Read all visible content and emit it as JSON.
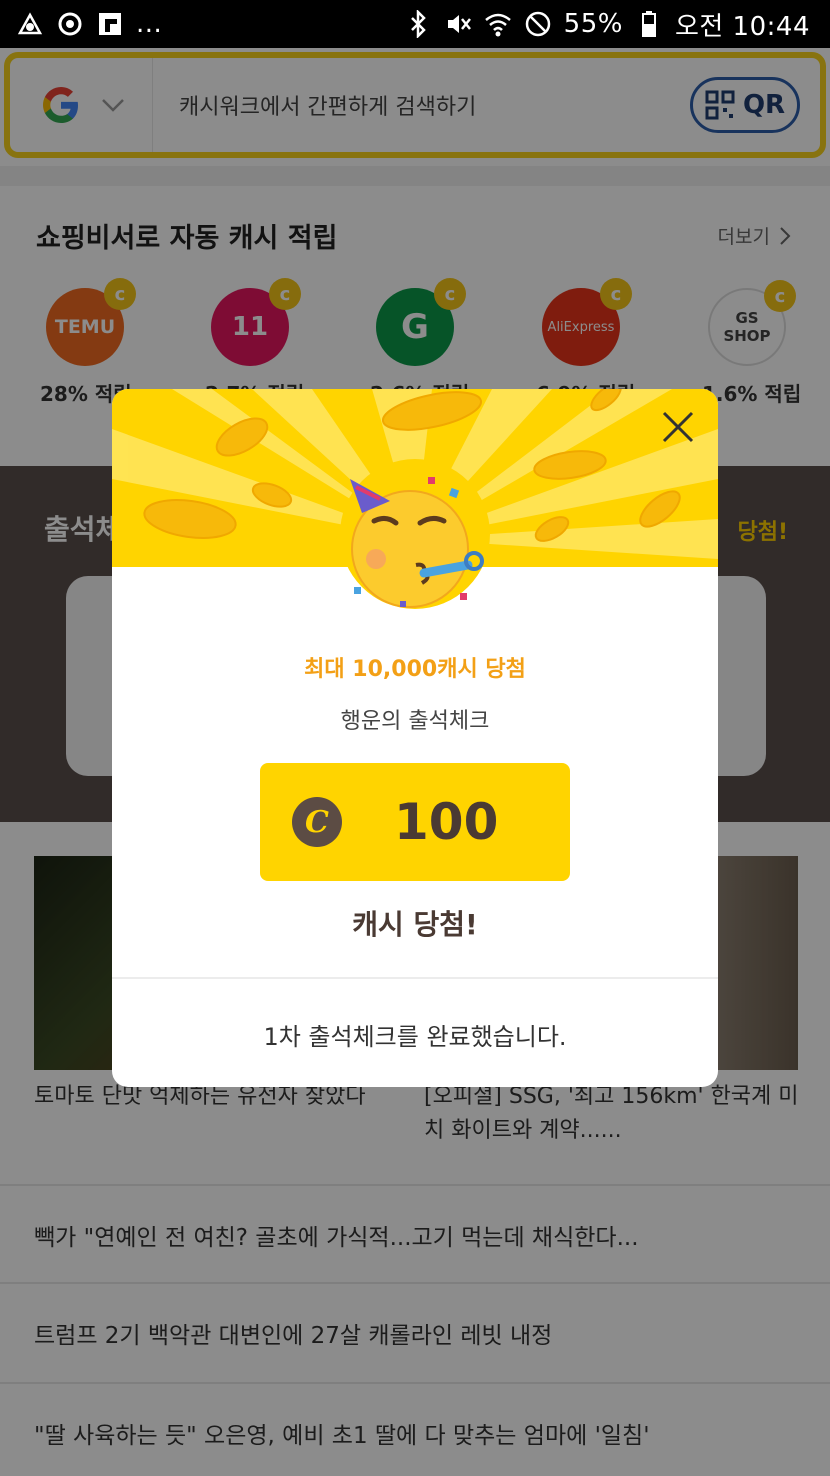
{
  "status_bar": {
    "left_icons": [
      "app-icon",
      "sync-icon",
      "flipboard-icon"
    ],
    "more": "...",
    "battery": "55%",
    "time": "오전 10:44"
  },
  "search": {
    "engine": "G",
    "placeholder": "캐시워크에서 간편하게 검색하기",
    "qr_label": "QR"
  },
  "shopping": {
    "title": "쇼핑비서로 자동 캐시 적립",
    "more_label": "더보기",
    "merchants": [
      {
        "name": "TEMU",
        "rate": "28% 적립",
        "color": "#f06a21"
      },
      {
        "name": "11",
        "rate": "2.7% 적립",
        "color": "#e6175f"
      },
      {
        "name": "G",
        "rate": "2.6% 적립",
        "color": "#0b9a4a"
      },
      {
        "name": "AliExpress",
        "rate": "6.9% 적립",
        "color": "#e8331a"
      },
      {
        "name": "GS SHOP",
        "rate": "1.6% 적립",
        "color": "#ffffff"
      }
    ]
  },
  "attendance": {
    "title": "출석체크",
    "right_text": "당첨!"
  },
  "news": {
    "card1": "토마토 단맛 억제하는 유전자 찾았다",
    "card2": "[오피셜] SSG, '최고 156km' 한국계 미치 화이트와 계약......",
    "rows": [
      "빽가 \"연예인 전 여친? 골초에 가식적...고기 먹는데 채식한다...",
      "트럼프 2기 백악관 대변인에 27살 캐롤라인 레빗 내정",
      "\"딸 사육하는 듯\" 오은영, 예비 초1 딸에 다 맞추는 엄마에 '일침'"
    ]
  },
  "modal": {
    "subtitle": "최대 10,000캐시 당첨",
    "title": "행운의 출석체크",
    "coin_symbol": "C",
    "prize": "100",
    "win_text": "캐시 당첨!",
    "done_text": "1차 출석체크를 완료했습니다.",
    "accent": "#ffd400"
  }
}
